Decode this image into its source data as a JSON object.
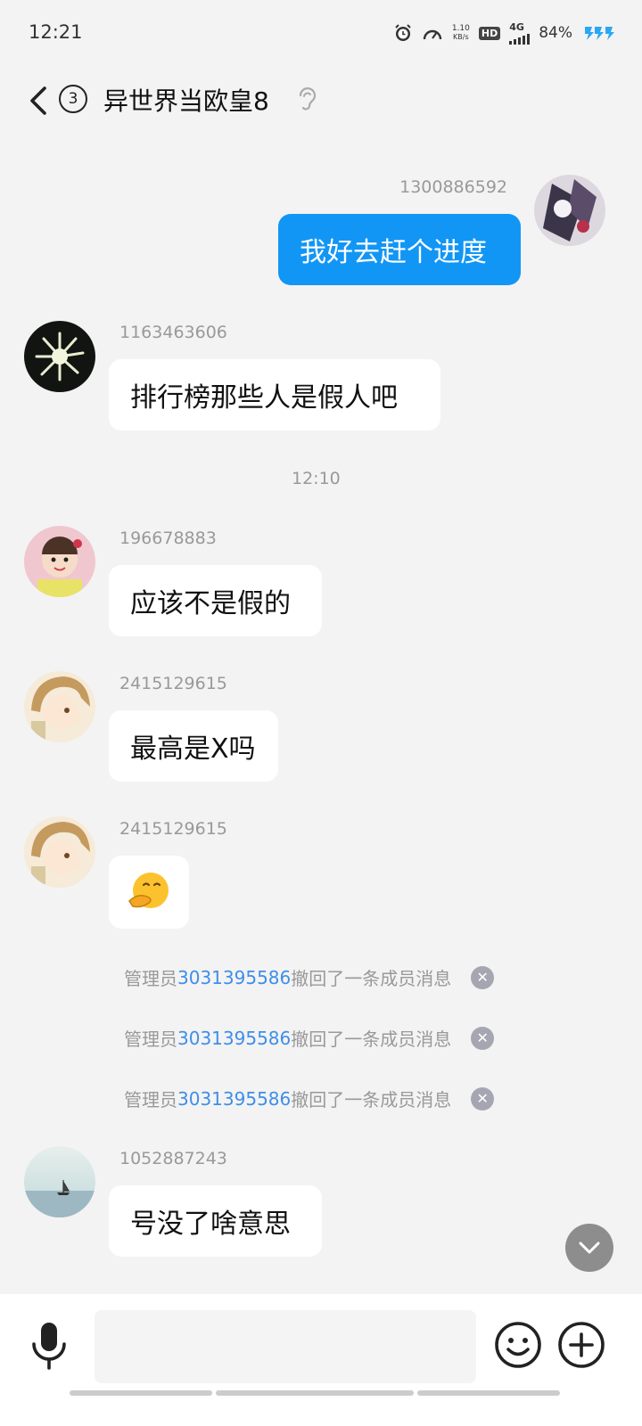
{
  "status_bar": {
    "time": "12:21",
    "net_speed_value": "1.10",
    "net_speed_unit": "KB/s",
    "hd_label": "HD",
    "network_label": "4G",
    "battery": "84%"
  },
  "header": {
    "unread_count": "3",
    "title": "异世界当欧皇8"
  },
  "messages": [
    {
      "sender": "1300886592",
      "text": "我好去赶个进度",
      "mine": true
    },
    {
      "sender": "1163463606",
      "text": "排行榜那些人是假人吧"
    },
    {
      "sender": "196678883",
      "text": "应该不是假的"
    },
    {
      "sender": "2415129615",
      "text": "最高是X吗"
    },
    {
      "sender": "2415129615",
      "emoji": "🫢"
    },
    {
      "sender": "1052887243",
      "text": "号没了啥意思"
    }
  ],
  "timestamp": "12:10",
  "recall_notices": [
    {
      "prefix": "管理员",
      "uid": "3031395586",
      "suffix": "撤回了一条成员消息"
    },
    {
      "prefix": "管理员",
      "uid": "3031395586",
      "suffix": "撤回了一条成员消息"
    },
    {
      "prefix": "管理员",
      "uid": "3031395586",
      "suffix": "撤回了一条成员消息"
    }
  ],
  "input": {
    "placeholder": ""
  },
  "colors": {
    "my_bubble": "#1296f5",
    "background": "#f3f3f3",
    "link_uid": "#3e8ee8"
  }
}
